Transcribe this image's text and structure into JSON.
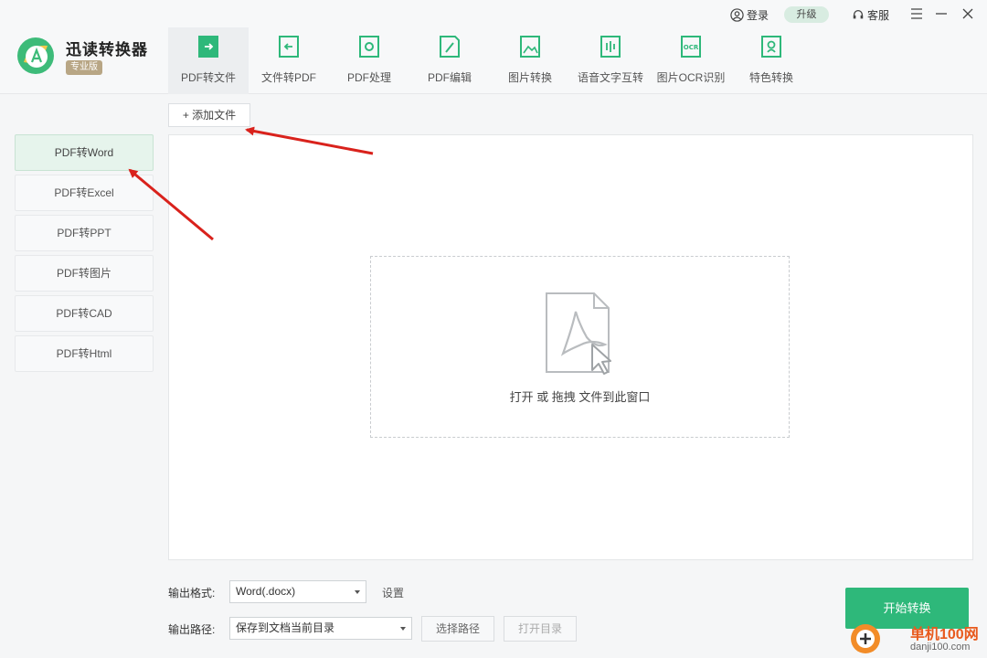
{
  "app": {
    "title": "迅读转换器",
    "edition": "专业版"
  },
  "top_actions": {
    "login": "登录",
    "upgrade": "升级",
    "service": "客服"
  },
  "tabs": [
    {
      "label": "PDF转文件",
      "icon": "pdf-to-file-icon"
    },
    {
      "label": "文件转PDF",
      "icon": "file-to-pdf-icon"
    },
    {
      "label": "PDF处理",
      "icon": "pdf-process-icon"
    },
    {
      "label": "PDF编辑",
      "icon": "pdf-edit-icon"
    },
    {
      "label": "图片转换",
      "icon": "image-convert-icon"
    },
    {
      "label": "语音文字互转",
      "icon": "speech-text-icon"
    },
    {
      "label": "图片OCR识别",
      "icon": "ocr-icon"
    },
    {
      "label": "特色转换",
      "icon": "special-convert-icon"
    }
  ],
  "sidebar": {
    "items": [
      {
        "label": "PDF转Word"
      },
      {
        "label": "PDF转Excel"
      },
      {
        "label": "PDF转PPT"
      },
      {
        "label": "PDF转图片"
      },
      {
        "label": "PDF转CAD"
      },
      {
        "label": "PDF转Html"
      }
    ]
  },
  "toolbar": {
    "add_file": "+ 添加文件"
  },
  "dropzone": {
    "hint": "打开 或 拖拽 文件到此窗口"
  },
  "output": {
    "format_label": "输出格式:",
    "format_value": "Word(.docx)",
    "settings": "设置",
    "path_label": "输出路径:",
    "path_value": "保存到文档当前目录",
    "choose_path": "选择路径",
    "open_dir": "打开目录"
  },
  "start_button": "开始转换",
  "watermark": {
    "text": "单机100网",
    "sub": "danji100.com"
  },
  "colors": {
    "accent": "#2eb87a",
    "arrow": "#d9221c",
    "active_bg": "#e6f4ec"
  }
}
